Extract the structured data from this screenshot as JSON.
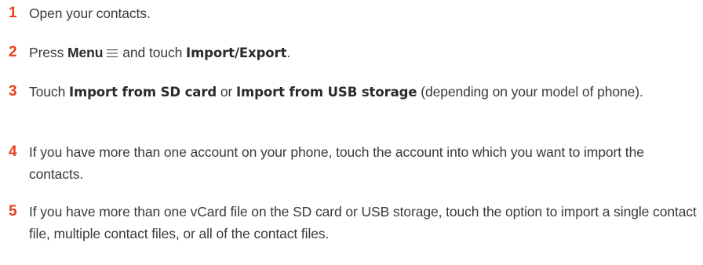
{
  "accent_color": "#e8411c",
  "steps": [
    {
      "number": "1",
      "text": "Open your contacts."
    },
    {
      "number": "2",
      "prefix": "Press",
      "menu_label": "Menu",
      "menu_icon": "menu-lines-icon",
      "middle": "and touch",
      "action": "Import/Export",
      "suffix": "."
    },
    {
      "number": "3",
      "prefix": "Touch",
      "option1": "Import from SD card",
      "middle": "or",
      "option2": "Import from USB storage",
      "suffix": "(depending on your model of phone)."
    },
    {
      "number": "4",
      "text": "If you have more than one account on your phone, touch the account into which you want to import the contacts."
    },
    {
      "number": "5",
      "text": "If you have more than one vCard file on the SD card or USB storage, touch the option to import a single contact file, multiple contact files, or all of the contact files."
    }
  ]
}
